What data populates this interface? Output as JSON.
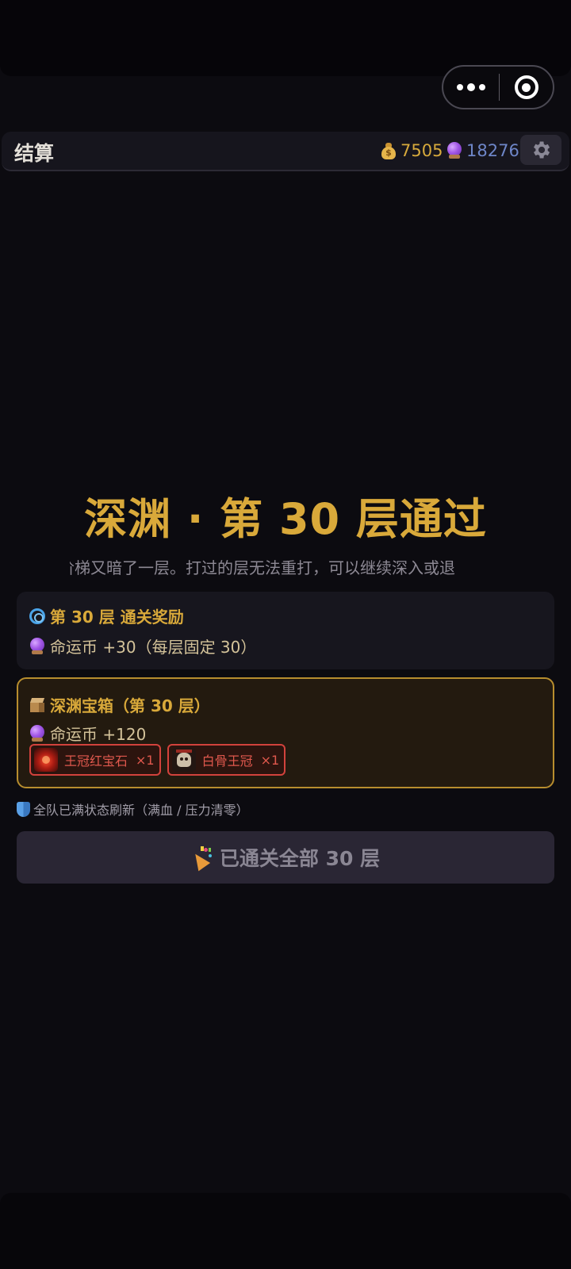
{
  "header": {
    "title": "结算",
    "gold": "7505",
    "crystal": "18276",
    "gold_icon": "money-bag-icon",
    "crystal_icon": "crystal-ball-icon",
    "settings_icon": "gear-icon"
  },
  "hero": {
    "title": "深渊 · 第 30 层通过",
    "subtitle": "阶梯又暗了一层。打过的层无法重打，可以继续深入或退"
  },
  "floor_reward": {
    "title": "第 30 层 通关奖励",
    "line": "命运币 +30（每层固定 30）"
  },
  "chest": {
    "title": "深渊宝箱（第 30 层）",
    "line": "命运币 +120",
    "items": [
      {
        "name": "王冠红宝石",
        "qty": "×1"
      },
      {
        "name": "白骨王冠",
        "qty": "×1"
      }
    ]
  },
  "status_text": "全队已满状态刷新（满血 / 压力清零）",
  "button_label": "已通关全部 30 层",
  "colors": {
    "gold": "#d9a93a",
    "crystal": "#6e86c8",
    "item_border": "#d2423c",
    "chest_border": "#b78d2e"
  }
}
